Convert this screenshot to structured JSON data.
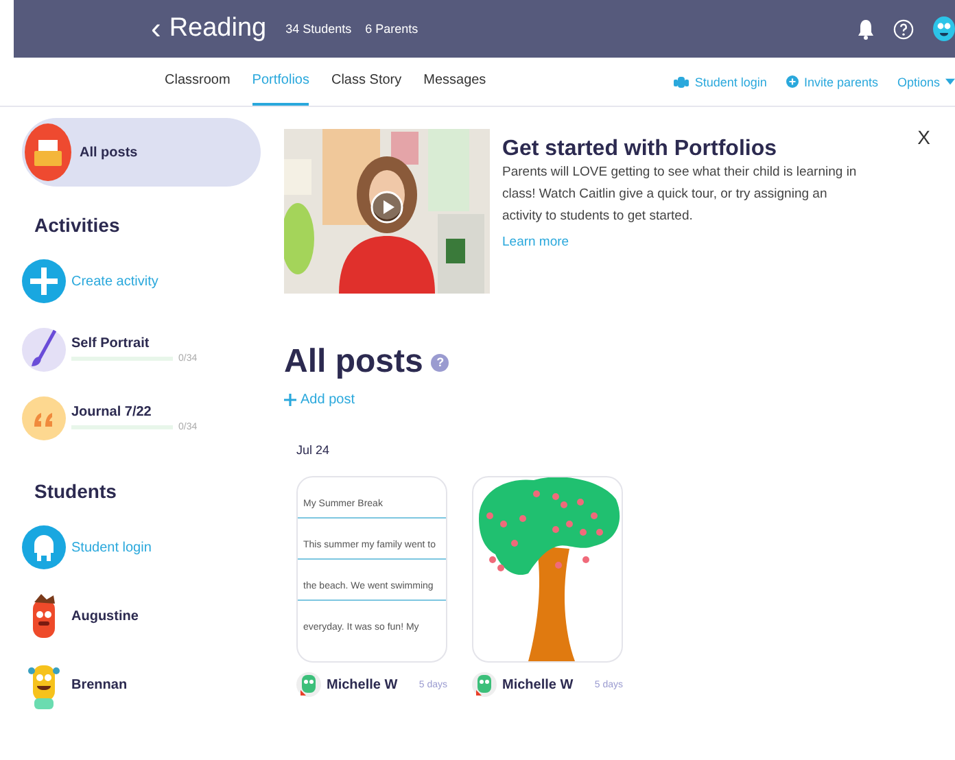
{
  "header": {
    "back": "‹",
    "title": "Reading",
    "students": "34 Students",
    "parents": "6 Parents"
  },
  "tabs": [
    {
      "label": "Classroom",
      "selected": false
    },
    {
      "label": "Portfolios",
      "selected": true
    },
    {
      "label": "Class Story",
      "selected": false
    },
    {
      "label": "Messages",
      "selected": false
    }
  ],
  "actions": [
    {
      "kind": "login",
      "label": "Student login"
    },
    {
      "kind": "invite",
      "label": "Invite parents"
    },
    {
      "kind": "options",
      "label": "Options"
    }
  ],
  "sidebar": {
    "all_posts": {
      "label": "All posts",
      "selected": true
    },
    "activities_heading": "Activities",
    "activities": [
      {
        "kind": "create",
        "label": "Create activity"
      },
      {
        "kind": "brush",
        "label": "Self Portrait",
        "progress": "0/34",
        "level": 0
      },
      {
        "kind": "quote",
        "label": "Journal 7/22",
        "progress": "0/34",
        "level": 0
      }
    ],
    "students_heading": "Students",
    "students": [
      {
        "kind": "login",
        "label": "Student login"
      },
      {
        "kind": "red",
        "label": "Augustine"
      },
      {
        "kind": "yellow",
        "label": "Brennan"
      }
    ]
  },
  "banner": {
    "title": "Get started with Portfolios",
    "text": "Parents will LOVE getting to see what their child is learning in class! Watch Caitlin give a quick tour, or try assigning an activity to students to get started.",
    "link": "Learn more",
    "close": "X"
  },
  "posts": {
    "title": "All posts",
    "help": "?",
    "add": "Add post",
    "date": "Jul 24",
    "items": [
      {
        "kind": "text",
        "lines": [
          "My Summer Break",
          "This summer my family went to",
          "the beach. We went swimming",
          "everyday. It was so fun! My"
        ],
        "author": "Michelle W",
        "age": "5 days"
      },
      {
        "kind": "drawing",
        "author": "Michelle W",
        "age": "5 days"
      }
    ]
  }
}
